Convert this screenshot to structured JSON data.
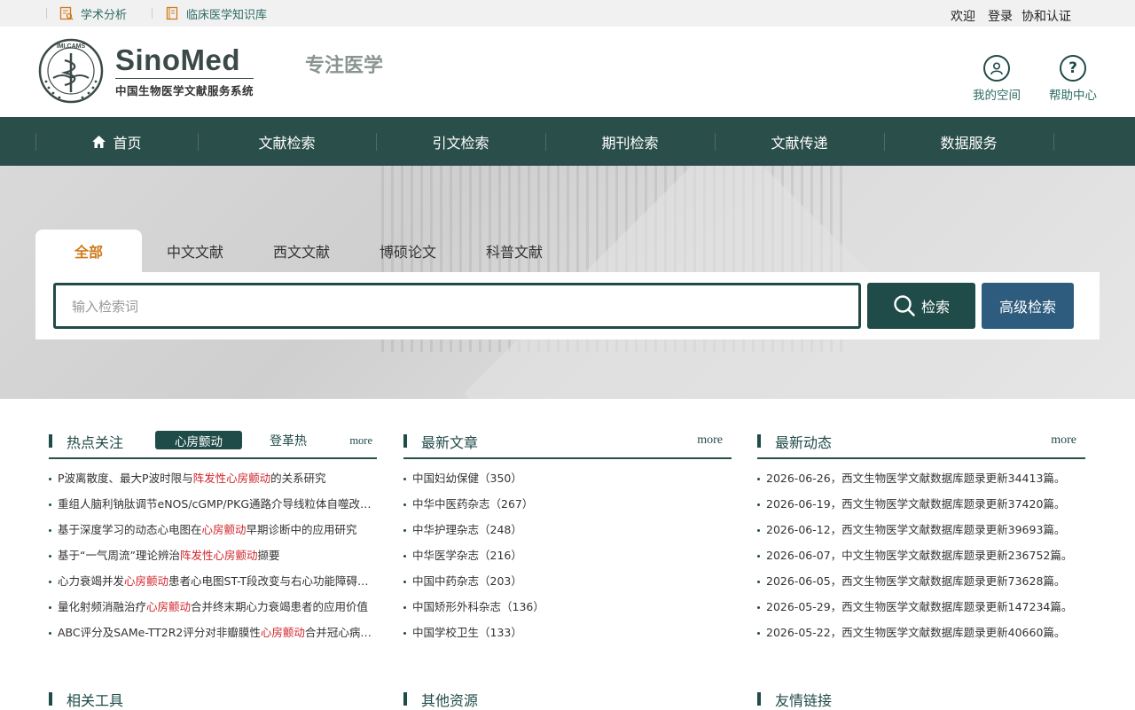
{
  "topbar": {
    "links": [
      {
        "label": "学术分析",
        "icon": "analysis-icon"
      },
      {
        "label": "临床医学知识库",
        "icon": "book-icon"
      }
    ],
    "welcome": "欢迎",
    "login": "登录",
    "consortium": "协和认证"
  },
  "header": {
    "logo_seal_text": "IMI.CAMS",
    "logo_en": "SinoMed",
    "logo_cn": "中国生物医学文献服务系统",
    "slogan": "专注医学",
    "my_space": "我的空间",
    "help": "帮助中心"
  },
  "nav": {
    "items": [
      "首页",
      "文献检索",
      "引文检索",
      "期刊检索",
      "文献传递",
      "数据服务"
    ]
  },
  "search": {
    "tabs": [
      "全部",
      "中文文献",
      "西文文献",
      "博硕论文",
      "科普文献"
    ],
    "active_tab": "全部",
    "placeholder": "输入检索词",
    "search_button": "检索",
    "advanced_button": "高级检索"
  },
  "hot": {
    "title": "热点关注",
    "active_topic": "心房颤动",
    "other_topic": "登革热",
    "more": "more",
    "items": [
      {
        "pre": "P波离散度、最大P波时限与",
        "hl": "阵发性心房颤动",
        "post": "的关系研究"
      },
      {
        "pre": "重组人脑利钠肽调节eNOS/cGMP/PKG通路介导线粒体自噬改善家兔",
        "hl": "",
        "post": ""
      },
      {
        "pre": "基于深度学习的动态心电图在",
        "hl": "心房颤动",
        "post": "早期诊断中的应用研究"
      },
      {
        "pre": "基于“一气周流”理论辨治",
        "hl": "阵发性心房颤动",
        "post": "撷要"
      },
      {
        "pre": "心力衰竭并发",
        "hl": "心房颤动",
        "post": "患者心电图ST-T段改变与右心功能障碍的关系"
      },
      {
        "pre": "量化射频消融治疗",
        "hl": "心房颤动",
        "post": "合并终末期心力衰竭患者的应用价值"
      },
      {
        "pre": "ABC评分及SAMe-TT2R2评分对非瓣膜性",
        "hl": "心房颤动",
        "post": "合并冠心病患者预后"
      }
    ]
  },
  "latest": {
    "title": "最新文章",
    "more": "more",
    "items": [
      "中国妇幼保健（350）",
      "中华中医药杂志（267）",
      "中华护理杂志（248）",
      "中华医学杂志（216）",
      "中国中药杂志（203）",
      "中国矫形外科杂志（136）",
      "中国学校卫生（133）"
    ]
  },
  "news": {
    "title": "最新动态",
    "more": "more",
    "items": [
      "2026-06-26，西文生物医学文献数据库题录更新34413篇。",
      "2026-06-19，西文生物医学文献数据库题录更新37420篇。",
      "2026-06-12，西文生物医学文献数据库题录更新39693篇。",
      "2026-06-07，中文生物医学文献数据库题录更新236752篇。",
      "2026-06-05，西文生物医学文献数据库题录更新73628篇。",
      "2026-05-29，西文生物医学文献数据库题录更新147234篇。",
      "2026-05-22，西文生物医学文献数据库题录更新40660篇。"
    ]
  },
  "bottom": {
    "tools": "相关工具",
    "resources": "其他资源",
    "links": "友情链接"
  },
  "colors": {
    "primary": "#1f4b48",
    "nav_bg": "#2a4e49",
    "accent_orange": "#d07a1a",
    "highlight_red": "#d0252b",
    "advanced_blue": "#2e5c7e"
  }
}
